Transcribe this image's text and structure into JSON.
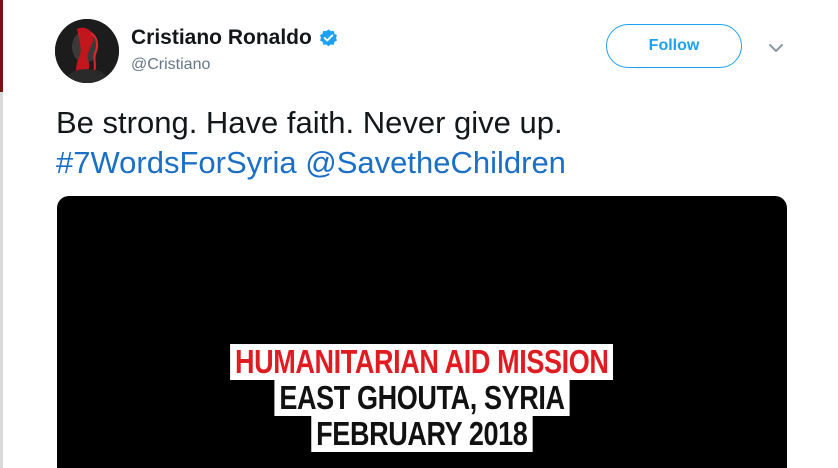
{
  "user": {
    "display_name": "Cristiano Ronaldo",
    "handle": "@Cristiano",
    "verified": true,
    "avatar_icon": "profile-photo"
  },
  "actions": {
    "follow_label": "Follow",
    "more_icon": "chevron-down-icon"
  },
  "tweet": {
    "text": "Be strong. Have faith. Never give up.",
    "hashtag": "#7WordsForSyria",
    "mention": "@SavetheChildren"
  },
  "media": {
    "line1": "HUMANITARIAN AID MISSION",
    "line2": "EAST GHOUTA, SYRIA",
    "line3": "FEBRUARY 2018"
  },
  "colors": {
    "link": "#1b6fc7",
    "brand_blue": "#1da1f2",
    "media_bg": "#000000",
    "caption_red": "#e11b22"
  }
}
